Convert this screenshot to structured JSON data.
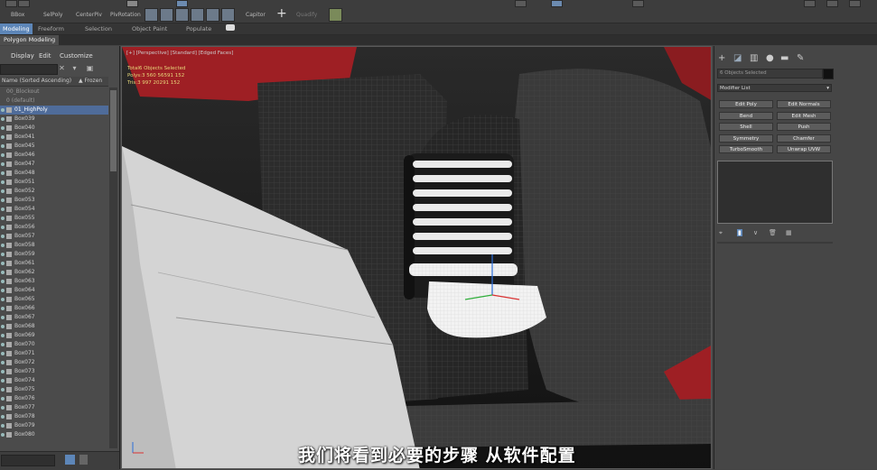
{
  "toolbar": {
    "buttons": [
      "BBox",
      "SelPoly",
      "CenterPiv",
      "PivRotation",
      "Capitor",
      "Quadify"
    ]
  },
  "ribbon": {
    "tabs": [
      "Modeling",
      "Freeform",
      "Selection",
      "Object Paint",
      "Populate"
    ],
    "sub_tab": "Polygon Modeling"
  },
  "scene_explorer": {
    "menu": [
      "Display",
      "Edit",
      "Customize"
    ],
    "header_sort": "Name (Sorted Ascending)",
    "header_frozen": "▲ Frozen",
    "layers": [
      "00_Blockout",
      "0 (default)"
    ],
    "selected_layer": "01_HighPoly",
    "items": [
      "Box039",
      "Box040",
      "Box041",
      "Box045",
      "Box046",
      "Box047",
      "Box048",
      "Box051",
      "Box052",
      "Box053",
      "Box054",
      "Box055",
      "Box056",
      "Box057",
      "Box058",
      "Box059",
      "Box061",
      "Box062",
      "Box063",
      "Box064",
      "Box065",
      "Box066",
      "Box067",
      "Box068",
      "Box069",
      "Box070",
      "Box071",
      "Box072",
      "Box073",
      "Box074",
      "Box075",
      "Box076",
      "Box077",
      "Box078",
      "Box079",
      "Box080"
    ]
  },
  "viewport": {
    "label": "[+] [Perspective] [Standard] [Edged Faces]",
    "stats": {
      "total_label": "Total",
      "selected_label": "6 Objects Selected",
      "polys_label": "Polys:",
      "polys_total": "3 560 565",
      "polys_selected": "91 152",
      "tris_label": "Tris:",
      "tris_total": "3 997 202",
      "tris_selected": "91 152"
    }
  },
  "subtitle": "我们将看到必要的步骤 从软件配置",
  "command_panel": {
    "selection_field": "6 Objects Selected",
    "modifier_list": "Modifier List",
    "modifier_buttons": [
      "Edit Poly",
      "Edit Normals",
      "Bend",
      "Edit Mesh",
      "Shell",
      "Push",
      "Symmetry",
      "Chamfer",
      "TurboSmooth",
      "Unwrap UVW"
    ]
  },
  "colors": {
    "accent": "#5d86b8",
    "stats_text": "#e8d77a",
    "model_red": "#9e1f24"
  }
}
